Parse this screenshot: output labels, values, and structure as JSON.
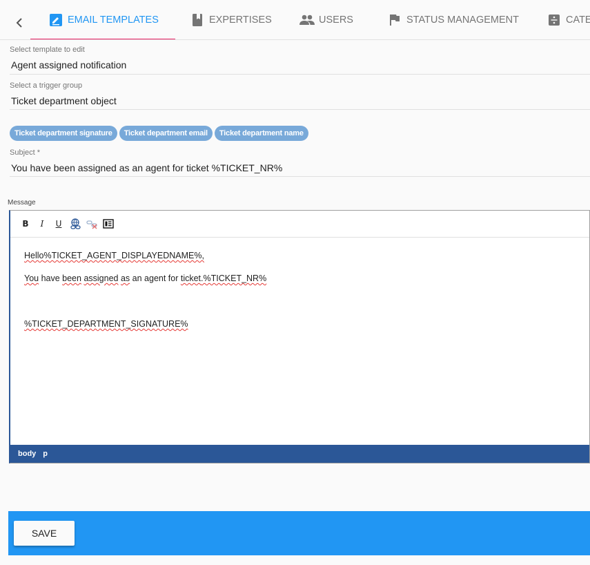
{
  "tabs": [
    {
      "label": "EMAIL TEMPLATES",
      "icon": "email-edit-icon",
      "active": true
    },
    {
      "label": "EXPERTISES",
      "icon": "book-icon",
      "active": false
    },
    {
      "label": "USERS",
      "icon": "people-icon",
      "active": false
    },
    {
      "label": "STATUS MANAGEMENT",
      "icon": "flag-icon",
      "active": false
    },
    {
      "label": "CATEG",
      "icon": "category-icon",
      "active": false
    }
  ],
  "form": {
    "template_label": "Select template to edit",
    "template_value": "Agent assigned notification",
    "trigger_label": "Select a trigger group",
    "trigger_value": "Ticket department object",
    "chips": [
      "Ticket department signature",
      "Ticket department email",
      "Ticket department name"
    ],
    "subject_label": "Subject *",
    "subject_value": "You have been assigned as an agent for ticket %TICKET_NR%",
    "message_label": "Message"
  },
  "editor": {
    "toolbar": {
      "bold": "B",
      "italic": "I",
      "underline": "U"
    },
    "lines": {
      "l1_hello": "Hello",
      "l1_var": "%TICKET_AGENT_DISPLAYEDNAME%,",
      "l2_you": "You",
      "l2_have": " have ",
      "l2_been": "been",
      "l2_sp1": " ",
      "l2_assigned": "assigned",
      "l2_sp2": " ",
      "l2_as": "as",
      "l2_mid": " an agent for ",
      "l2_ticket": "ticket",
      "l2_var": ".%TICKET_NR%",
      "l3_var": "%TICKET_DEPARTMENT_SIGNATURE%"
    },
    "path": [
      "body",
      "p"
    ]
  },
  "actions": {
    "save_label": "SAVE"
  },
  "colors": {
    "accent": "#2196f3",
    "tab_indicator": "#e91e63",
    "chip": "#78a9d9",
    "editor_status": "#2b5797"
  }
}
